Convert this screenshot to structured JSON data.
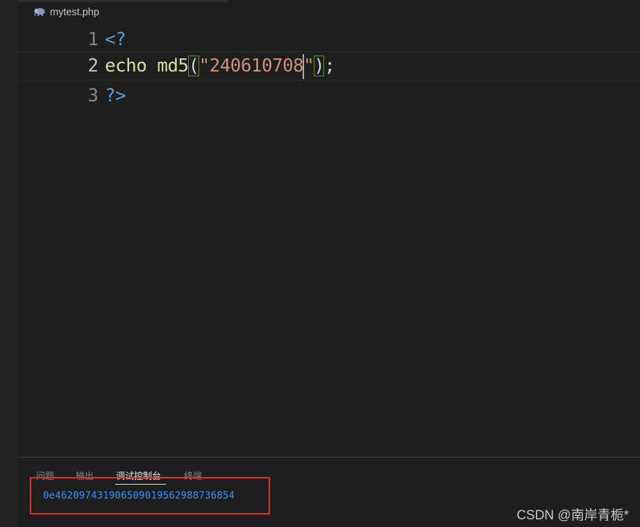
{
  "editor": {
    "tab": {
      "label": "mytest.php",
      "icon": "php-elephant-icon"
    },
    "lines": [
      {
        "number": "1",
        "text": "<?"
      },
      {
        "number": "2",
        "text": "echo md5(\"240610708\");"
      },
      {
        "number": "3",
        "text": "?>"
      }
    ],
    "line2_tokens": {
      "keyword": "echo",
      "space": " ",
      "function": "md5",
      "open_paren": "(",
      "quote_open": "\"",
      "string": "240610708",
      "quote_close": "\"",
      "close_paren": ")",
      "semicolon": ";"
    }
  },
  "panel": {
    "tabs": [
      {
        "label": "问题"
      },
      {
        "label": "输出"
      },
      {
        "label": "调试控制台",
        "active": true
      },
      {
        "label": "终端"
      }
    ],
    "console_output": "0e462097431906509019562988736854"
  },
  "watermark": "CSDN @南岸青栀*",
  "colors": {
    "background": "#1e1e1e",
    "php_tag": "#569cd6",
    "function": "#dcdcaa",
    "string": "#ce9178",
    "console_text": "#3794ff",
    "highlight_box": "#e03030"
  }
}
